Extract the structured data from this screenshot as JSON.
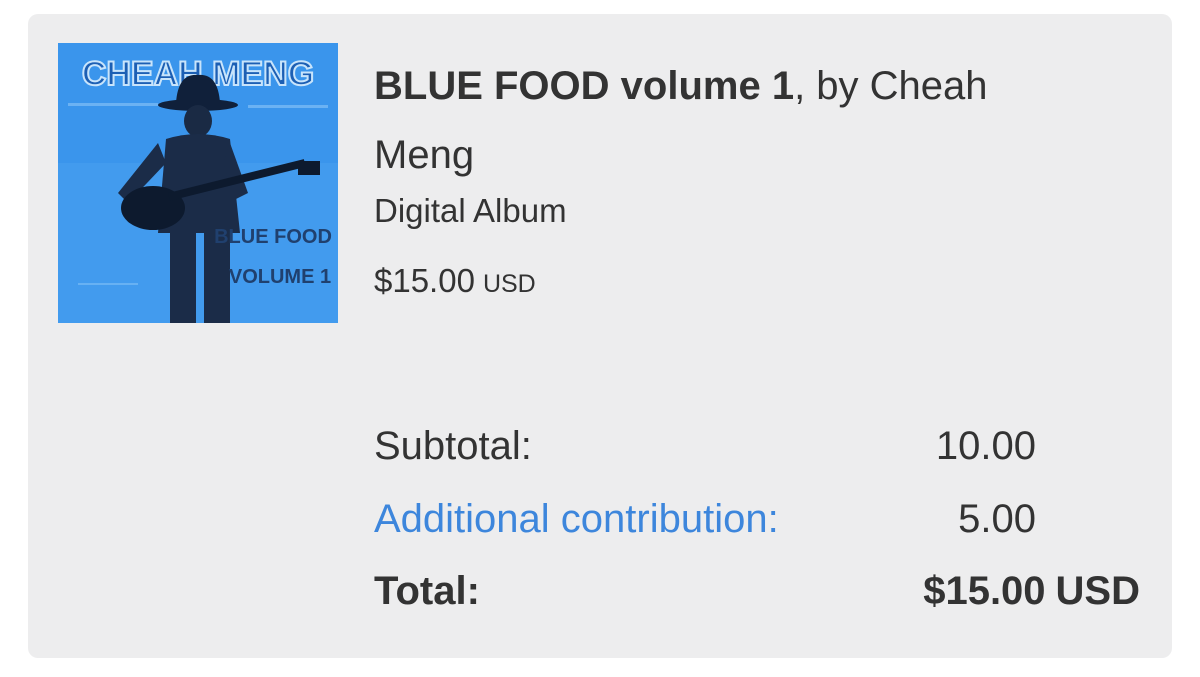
{
  "item": {
    "album_title": "BLUE FOOD volume 1",
    "by_artist": ", by Cheah Meng",
    "format": "Digital Album",
    "price": "$15.00",
    "currency": "USD",
    "cover": {
      "top_text": "CHEAH MENG",
      "side_text_1": "BLUE FOOD",
      "side_text_2": "VOLUME 1",
      "background_color": "#3a95ec"
    }
  },
  "summary": {
    "subtotal_label": "Subtotal:",
    "subtotal_value": "10.00",
    "contribution_label": "Additional contribution:",
    "contribution_value": "5.00",
    "total_label": "Total:",
    "total_value": "$15.00",
    "total_currency": "USD"
  },
  "colors": {
    "card_background": "#ededee",
    "text": "#333333",
    "link": "#3d86dc"
  }
}
